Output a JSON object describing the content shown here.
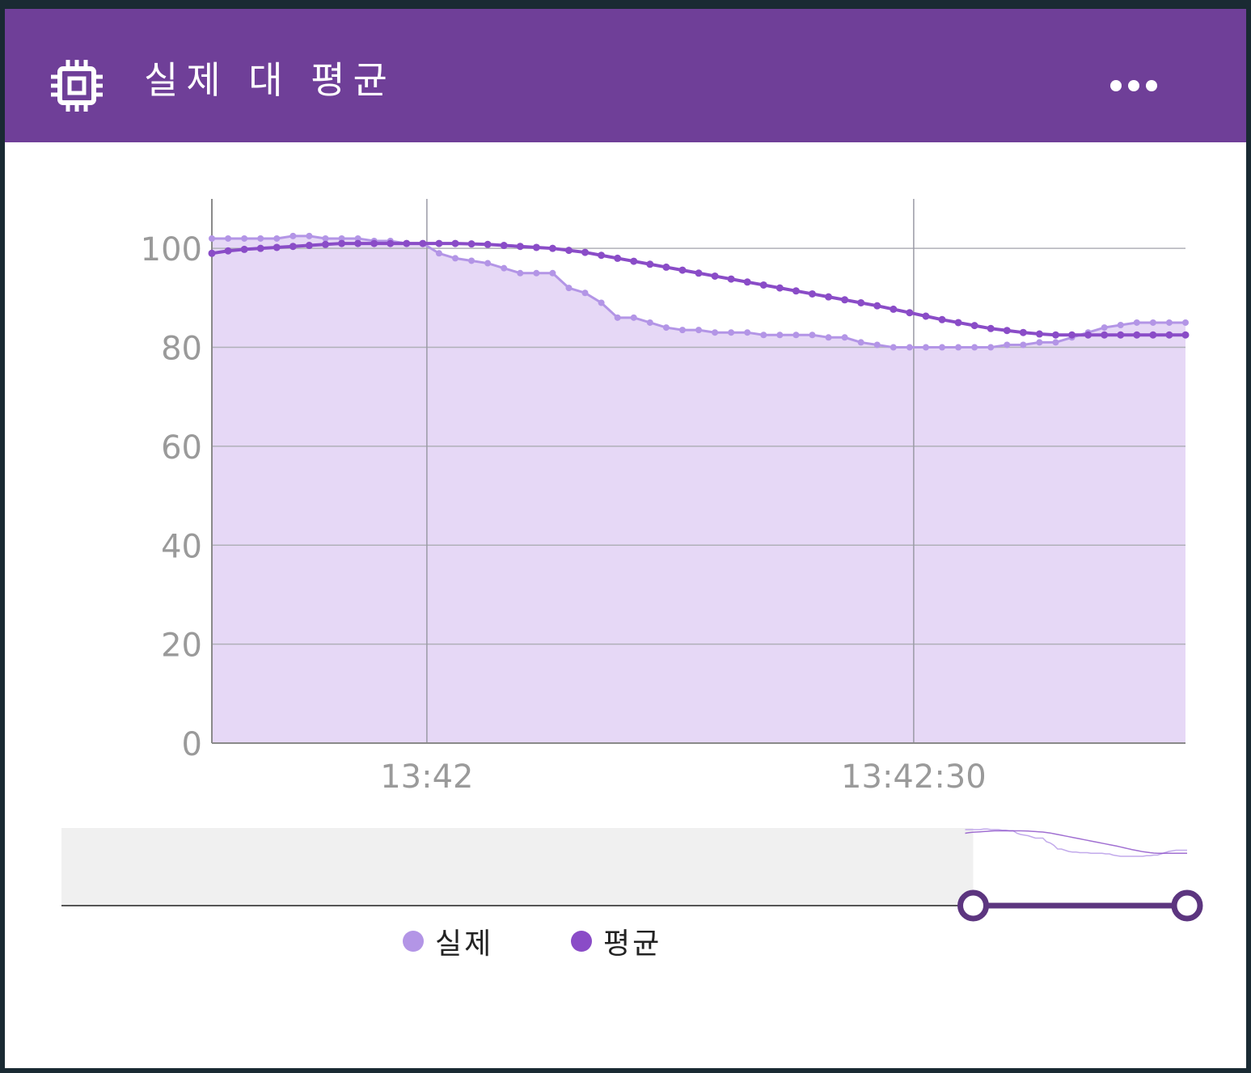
{
  "colors": {
    "header": "#6f3f98",
    "actual": "#b395e6",
    "average": "#8a4cc7",
    "area": "#e6d8f6",
    "grid": "#b0b0b8",
    "handle": "#5c357f"
  },
  "header": {
    "title": "실제 대 평균",
    "icon": "chip-icon",
    "menu_icon": "more-horizontal-icon"
  },
  "chart_data": {
    "type": "line",
    "x_ticks": [
      "13:42",
      "13:42:30"
    ],
    "x_tick_positions": [
      13.25,
      43.25
    ],
    "y_ticks": [
      "0",
      "20",
      "40",
      "60",
      "80",
      "100"
    ],
    "ylim": [
      0,
      110
    ],
    "xlim": [
      0,
      60
    ],
    "grid": true,
    "legend_position": "bottom",
    "series": [
      {
        "name": "실제",
        "color": "#b395e6",
        "x": [
          0,
          1,
          2,
          3,
          4,
          5,
          6,
          7,
          8,
          9,
          10,
          11,
          12,
          13,
          14,
          15,
          16,
          17,
          18,
          19,
          20,
          21,
          22,
          23,
          24,
          25,
          26,
          27,
          28,
          29,
          30,
          31,
          32,
          33,
          34,
          35,
          36,
          37,
          38,
          39,
          40,
          41,
          42,
          43,
          44,
          45,
          46,
          47,
          48,
          49,
          50,
          51,
          52,
          53,
          54,
          55,
          56,
          57,
          58,
          59,
          60
        ],
        "values": [
          102,
          102,
          102,
          102,
          102,
          102.5,
          102.5,
          102,
          102,
          102,
          101.5,
          101.5,
          101,
          101,
          99,
          98,
          97.5,
          97,
          96,
          95,
          95,
          95,
          92,
          91,
          89,
          86,
          86,
          85,
          84,
          83.5,
          83.5,
          83,
          83,
          83,
          82.5,
          82.5,
          82.5,
          82.5,
          82,
          82,
          81,
          80.5,
          80,
          80,
          80,
          80,
          80,
          80,
          80,
          80.5,
          80.5,
          81,
          81,
          82,
          83,
          84,
          84.5,
          85,
          85,
          85,
          85
        ]
      },
      {
        "name": "평균",
        "color": "#8a4cc7",
        "x": [
          0,
          1,
          2,
          3,
          4,
          5,
          6,
          7,
          8,
          9,
          10,
          11,
          12,
          13,
          14,
          15,
          16,
          17,
          18,
          19,
          20,
          21,
          22,
          23,
          24,
          25,
          26,
          27,
          28,
          29,
          30,
          31,
          32,
          33,
          34,
          35,
          36,
          37,
          38,
          39,
          40,
          41,
          42,
          43,
          44,
          45,
          46,
          47,
          48,
          49,
          50,
          51,
          52,
          53,
          54,
          55,
          56,
          57,
          58,
          59,
          60
        ],
        "values": [
          99,
          99.5,
          99.8,
          100,
          100.2,
          100.4,
          100.6,
          100.8,
          101,
          101,
          101,
          101,
          101,
          101,
          101,
          101,
          100.9,
          100.8,
          100.6,
          100.4,
          100.2,
          100,
          99.6,
          99.2,
          98.6,
          98,
          97.4,
          96.8,
          96.2,
          95.6,
          95,
          94.4,
          93.8,
          93.2,
          92.6,
          92,
          91.4,
          90.8,
          90.2,
          89.6,
          89,
          88.4,
          87.7,
          87,
          86.3,
          85.6,
          85,
          84.4,
          83.8,
          83.4,
          83,
          82.7,
          82.5,
          82.5,
          82.5,
          82.5,
          82.5,
          82.5,
          82.5,
          82.5,
          82.5
        ]
      }
    ]
  },
  "legend": [
    {
      "label": "실제",
      "color": "#b395e6"
    },
    {
      "label": "평균",
      "color": "#8a4cc7"
    }
  ],
  "navigator": {
    "selected_range": [
      0.81,
      1.0
    ]
  }
}
